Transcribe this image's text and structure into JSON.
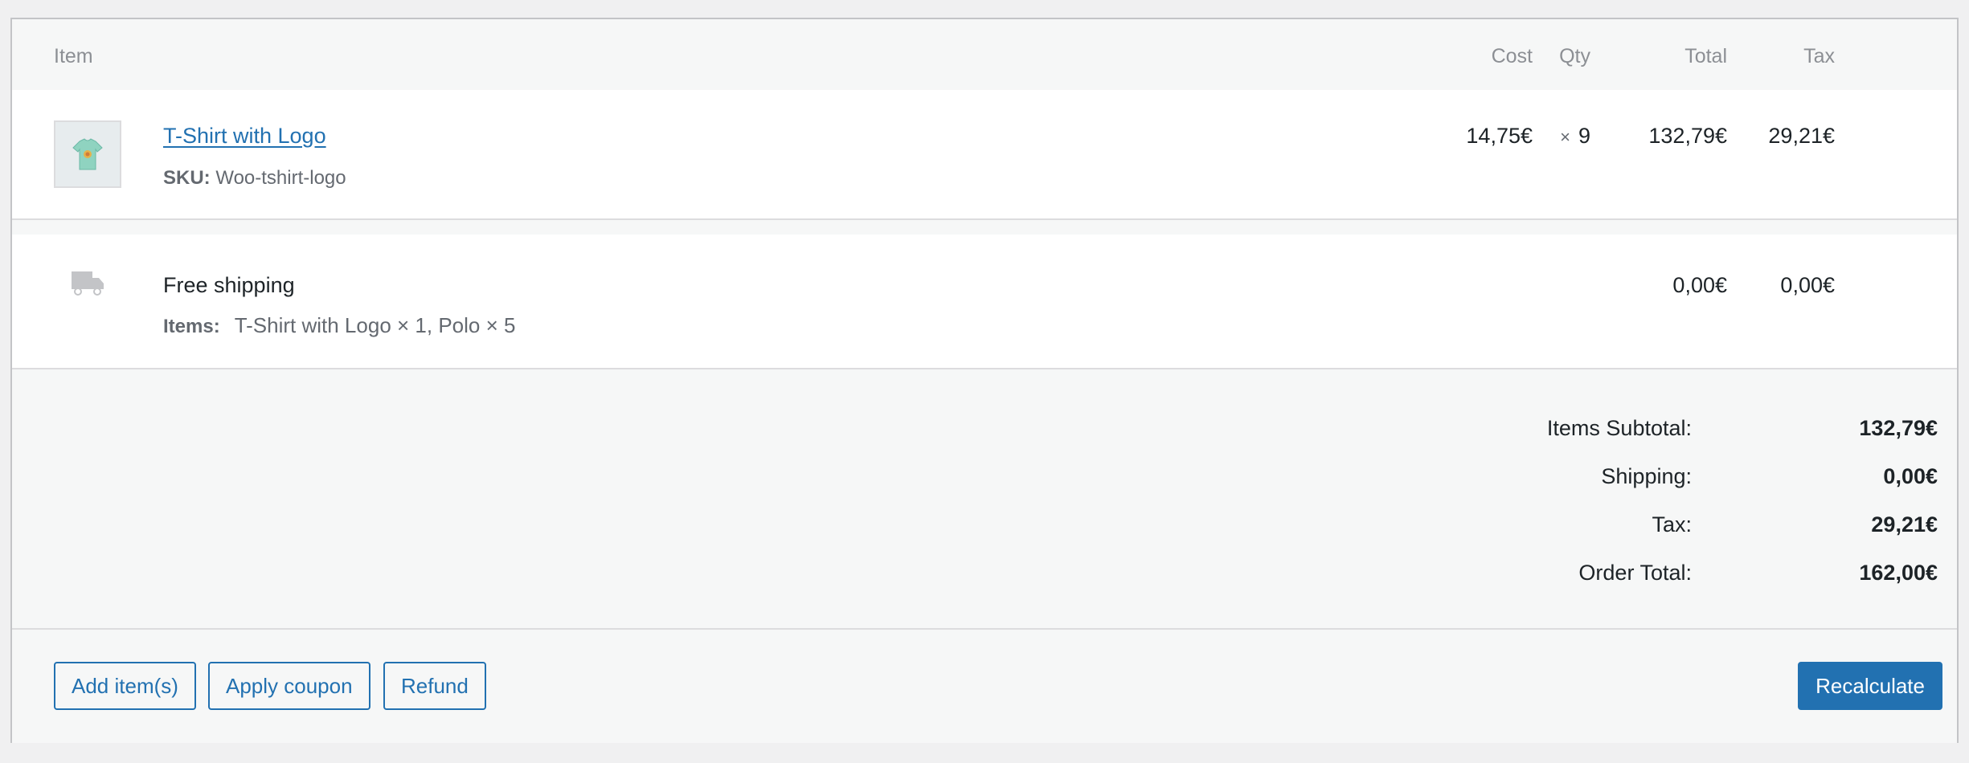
{
  "table": {
    "headers": {
      "item": "Item",
      "cost": "Cost",
      "qty": "Qty",
      "total": "Total",
      "tax": "Tax"
    }
  },
  "line_item": {
    "name": "T-Shirt with Logo",
    "sku_label": "SKU:",
    "sku_value": "Woo-tshirt-logo",
    "cost": "14,75€",
    "qty_symbol": "×",
    "qty": "9",
    "total": "132,79€",
    "tax": "29,21€"
  },
  "shipping_line": {
    "name": "Free shipping",
    "items_label": "Items:",
    "items_value": "T-Shirt with Logo × 1, Polo × 5",
    "total": "0,00€",
    "tax": "0,00€"
  },
  "totals": {
    "subtotal_label": "Items Subtotal:",
    "subtotal_value": "132,79€",
    "shipping_label": "Shipping:",
    "shipping_value": "0,00€",
    "tax_label": "Tax:",
    "tax_value": "29,21€",
    "order_total_label": "Order Total:",
    "order_total_value": "162,00€"
  },
  "actions": {
    "add_items": "Add item(s)",
    "apply_coupon": "Apply coupon",
    "refund": "Refund",
    "recalculate": "Recalculate"
  },
  "colors": {
    "accent": "#2271b1",
    "panel_bg": "#f6f7f7",
    "row_bg": "#ffffff",
    "border": "#dcdcde"
  },
  "icons": {
    "product_thumbnail": "tshirt-thumbnail",
    "shipping": "truck-icon"
  }
}
